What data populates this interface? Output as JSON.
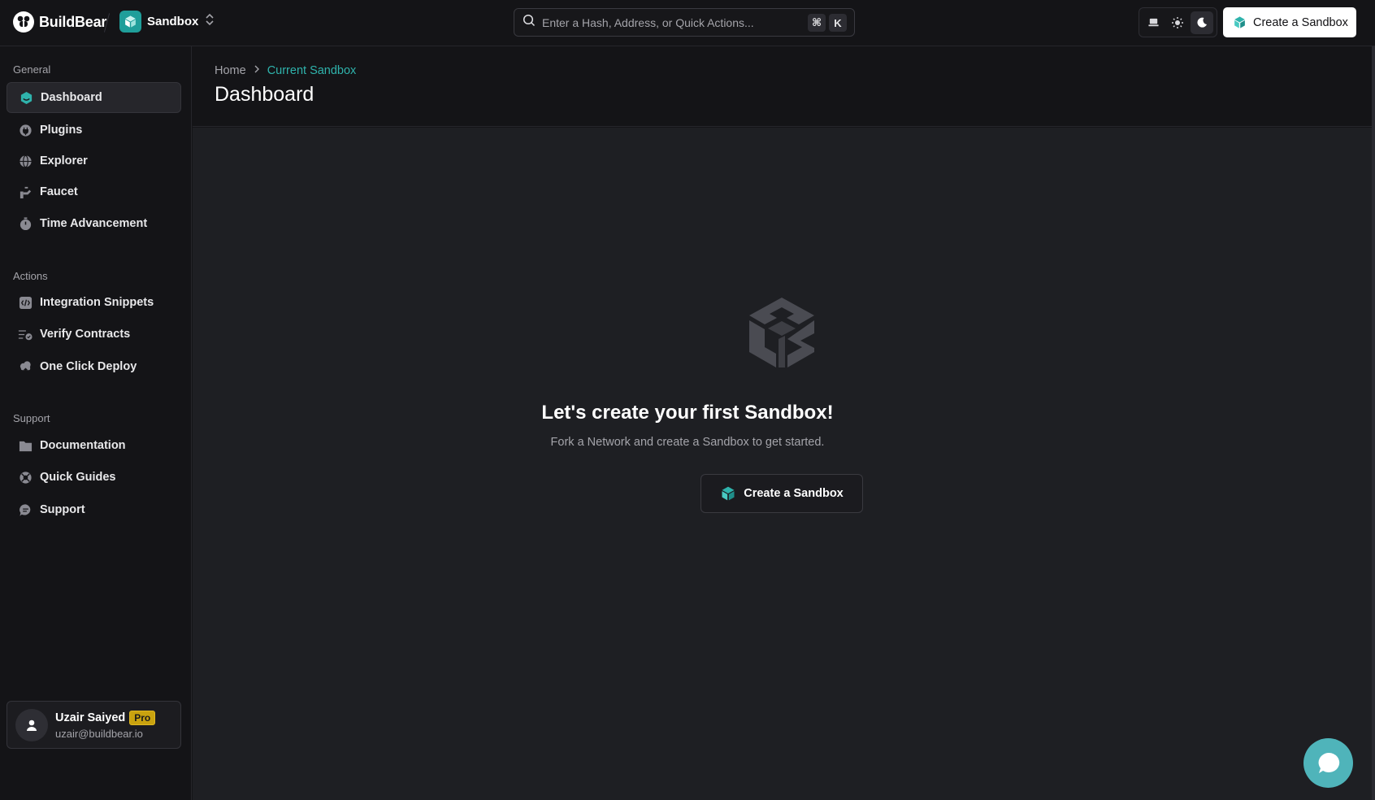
{
  "brand": {
    "name": "BuildBear"
  },
  "sandbox_switcher": {
    "label": "Sandbox"
  },
  "search": {
    "placeholder": "Enter a Hash, Address, or Quick Actions...",
    "shortcut_key1": "⌘",
    "shortcut_key2": "K"
  },
  "header": {
    "create_button": "Create a Sandbox"
  },
  "sidebar": {
    "sections": [
      {
        "title": "General",
        "items": [
          {
            "label": "Dashboard",
            "icon": "dashboard-icon",
            "active": true
          },
          {
            "label": "Plugins",
            "icon": "plugins-icon"
          },
          {
            "label": "Explorer",
            "icon": "globe-icon"
          },
          {
            "label": "Faucet",
            "icon": "faucet-icon"
          },
          {
            "label": "Time Advancement",
            "icon": "timer-icon"
          }
        ]
      },
      {
        "title": "Actions",
        "items": [
          {
            "label": "Integration Snippets",
            "icon": "code-icon"
          },
          {
            "label": "Verify Contracts",
            "icon": "verify-icon"
          },
          {
            "label": "One Click Deploy",
            "icon": "cloud-deploy-icon"
          }
        ]
      },
      {
        "title": "Support",
        "items": [
          {
            "label": "Documentation",
            "icon": "folder-icon"
          },
          {
            "label": "Quick Guides",
            "icon": "lifebuoy-icon"
          },
          {
            "label": "Support",
            "icon": "chat-icon"
          }
        ]
      }
    ]
  },
  "user": {
    "name": "Uzair Saiyed",
    "badge": "Pro",
    "email": "uzair@buildbear.io"
  },
  "breadcrumb": {
    "home": "Home",
    "current": "Current Sandbox"
  },
  "page": {
    "title": "Dashboard"
  },
  "empty_state": {
    "title": "Let's create your first Sandbox!",
    "subtitle": "Fork a Network and create a Sandbox to get started.",
    "button": "Create a Sandbox"
  },
  "colors": {
    "accent": "#2fb3ac",
    "chat_bubble": "#4fb4ba",
    "pro_badge": "#c9a20f"
  }
}
